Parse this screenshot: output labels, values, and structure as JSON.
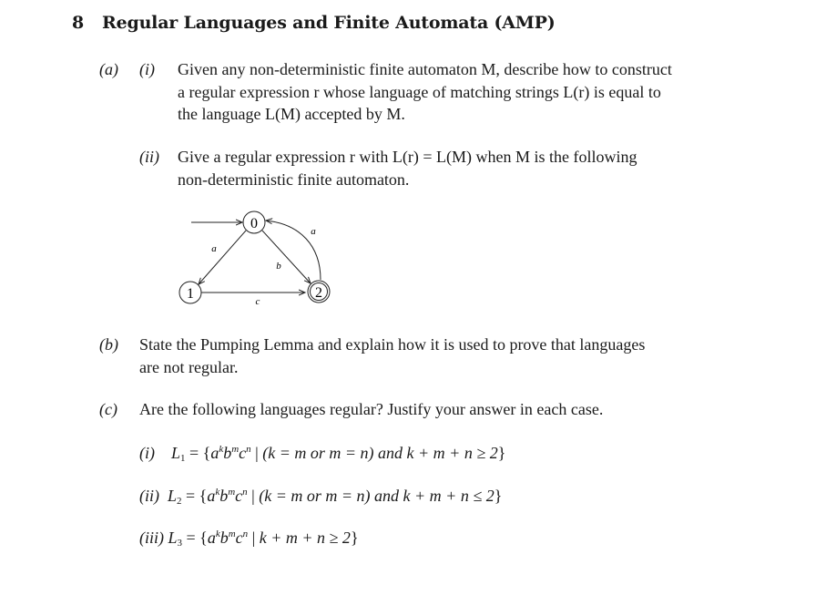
{
  "section": {
    "number": "8",
    "title": "Regular Languages and Finite Automata (AMP)"
  },
  "part_a": {
    "label": "(a)",
    "sub_i": {
      "label": "(i)",
      "lines": [
        "Given any non-deterministic finite automaton M, describe how to construct",
        "a regular expression r whose language of matching strings L(r) is equal to",
        "the language L(M) accepted by M."
      ]
    },
    "sub_ii": {
      "label": "(ii)",
      "lines": [
        "Give a regular expression r with L(r) = L(M) when M is the following",
        "non-deterministic finite automaton."
      ]
    },
    "automaton": {
      "states": [
        {
          "id": "0",
          "start": true,
          "accepting": false
        },
        {
          "id": "1",
          "start": false,
          "accepting": false
        },
        {
          "id": "2",
          "start": false,
          "accepting": true
        }
      ],
      "transitions": [
        {
          "from": "0",
          "to": "1",
          "symbol": "a"
        },
        {
          "from": "0",
          "to": "2",
          "symbol": "b"
        },
        {
          "from": "2",
          "to": "0",
          "symbol": "a"
        },
        {
          "from": "1",
          "to": "2",
          "symbol": "c"
        }
      ]
    }
  },
  "part_b": {
    "label": "(b)",
    "lines": [
      "State the Pumping Lemma and explain how it is used to prove that languages",
      "are not regular."
    ]
  },
  "part_c": {
    "label": "(c)",
    "intro": "Are the following languages regular? Justify your answer in each case.",
    "items": [
      {
        "label": "(i)",
        "name": "L",
        "index": "1",
        "condition": "(k = m or m = n) and k + m + n ≥ 2"
      },
      {
        "label": "(ii)",
        "name": "L",
        "index": "2",
        "condition": "(k = m or m = n) and k + m + n ≤ 2"
      },
      {
        "label": "(iii)",
        "name": "L",
        "index": "3",
        "condition": "k + m + n ≥ 2"
      }
    ],
    "set_prefix": "= {",
    "word": {
      "a": "a",
      "a_exp": "k",
      "b": "b",
      "b_exp": "m",
      "c": "c",
      "c_exp": "n"
    },
    "separator": " | ",
    "set_suffix": "}"
  }
}
